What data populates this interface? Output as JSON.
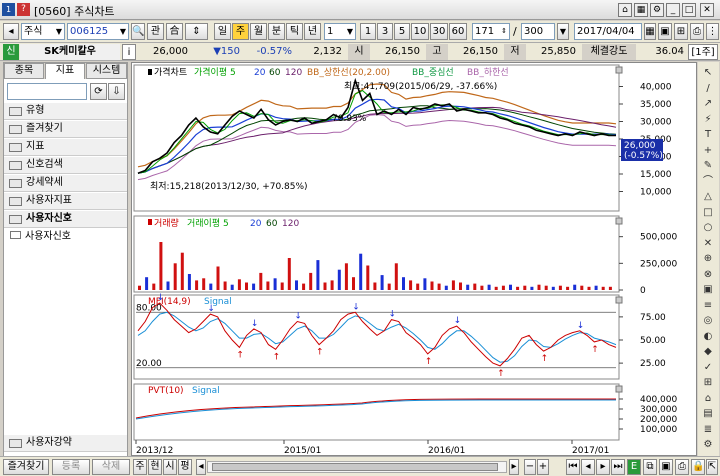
{
  "window": {
    "number_badge": "1",
    "help_badge": "?",
    "title": "[0560] 주식차트"
  },
  "toolbar": {
    "market": "주식",
    "code": "006125",
    "btn_chart": "관",
    "btn_up": "合",
    "periods": [
      "일",
      "주",
      "월",
      "분",
      "틱",
      "년"
    ],
    "selected_period": "주",
    "interval": "1",
    "intervals": [
      "1",
      "3",
      "5",
      "10",
      "30",
      "60"
    ],
    "bar_count": "171",
    "slash": "/",
    "max_count": "300",
    "date": "2017/04/04"
  },
  "quote": {
    "market_badge": "신",
    "name": "SK케미칼우",
    "info_btn": "i",
    "price": "26,000",
    "change": "▼150",
    "change_pct": "-0.57%",
    "volume": "2,132",
    "open_label": "시",
    "open": "26,150",
    "high_label": "고",
    "high": "26,150",
    "low_label": "저",
    "low": "25,850",
    "strength_label": "체결강도",
    "strength": "36.04",
    "unit": "[1주]"
  },
  "sidebar": {
    "tabs": [
      "종목",
      "지표",
      "시스템"
    ],
    "active_tab": "지표",
    "folders": [
      "유형",
      "즐겨찾기",
      "지표",
      "신호검색",
      "강세약세",
      "사용자지표",
      "사용자신호"
    ],
    "subitem": "사용자신호",
    "bottom_folder": "사용자강약"
  },
  "bottom_bar": {
    "btns": [
      "즐겨찾기",
      "등록",
      "삭제"
    ],
    "small_btns": [
      "주",
      "현",
      "시",
      "평"
    ]
  },
  "chart_data": [
    {
      "type": "line",
      "panel": "price",
      "legend": [
        "가격차트",
        "가격이평 5",
        "20",
        "60",
        "120",
        "BB_상한선(20,2.00)",
        "BB_중심선",
        "BB_하한선"
      ],
      "colors": {
        "price": "#000000",
        "ma5": "#00a000",
        "ma20": "#1a3fd6",
        "ma60": "#004400",
        "ma120": "#6b1f6b",
        "bb_up": "#c0681a",
        "bb_mid": "#119944",
        "bb_low": "#aa66aa"
      },
      "y_ticks": [
        "40,000",
        "35,000",
        "30,000",
        "25,000",
        "20,000",
        "15,000",
        "10,000"
      ],
      "ylim": [
        5000,
        45000
      ],
      "annotations": {
        "max": "최고:41,709(2015/06/29, -37.66%)",
        "min": "최저:15,218(2013/12/30, +70.85%)",
        "mid": "70.93%"
      },
      "last_price": "26,000",
      "last_change": "(-0.57%)",
      "price": [
        15218,
        16000,
        18500,
        19500,
        21000,
        24000,
        26000,
        29000,
        31000,
        28500,
        27000,
        26500,
        29000,
        31500,
        33000,
        32000,
        31000,
        33500,
        30500,
        29000,
        30000,
        30500,
        30000,
        31000,
        29500,
        30000,
        30500,
        32000,
        31000,
        34000,
        41709,
        36000,
        38000,
        32000,
        33000,
        32000,
        33500,
        32000,
        34000,
        33500,
        34000,
        35000,
        34500,
        35000,
        33000,
        33500,
        33000,
        32500,
        32500,
        32000,
        31000,
        30500,
        29500,
        29000,
        28500,
        27500,
        27000,
        26500,
        26000,
        26500,
        26000,
        27000,
        26500,
        26000,
        26500,
        26000,
        26000
      ]
    },
    {
      "type": "bar",
      "panel": "volume",
      "legend": [
        "거래량",
        "거래이평 5",
        "20",
        "60",
        "120"
      ],
      "y_ticks": [
        "500,000",
        "250,000",
        "0"
      ],
      "ylim": [
        0,
        600000
      ],
      "values": [
        40000,
        120000,
        60000,
        450000,
        80000,
        250000,
        350000,
        150000,
        90000,
        110000,
        60000,
        220000,
        80000,
        50000,
        100000,
        70000,
        60000,
        160000,
        80000,
        110000,
        70000,
        300000,
        90000,
        60000,
        160000,
        280000,
        70000,
        90000,
        190000,
        250000,
        120000,
        340000,
        230000,
        70000,
        140000,
        60000,
        250000,
        120000,
        90000,
        60000,
        110000,
        80000,
        60000,
        40000,
        90000,
        70000,
        50000,
        60000,
        40000,
        50000,
        30000,
        40000,
        50000,
        30000,
        40000,
        30000,
        50000,
        40000,
        30000,
        40000,
        30000,
        50000,
        40000,
        30000,
        40000,
        30000,
        30000
      ]
    },
    {
      "type": "line",
      "panel": "mfi",
      "legend": [
        "MFI(14,9)",
        "Signal"
      ],
      "y_ticks": [
        "75.00",
        "50.00",
        "25.00"
      ],
      "levels": [
        "80.00",
        "20.00"
      ],
      "ylim": [
        10,
        90
      ],
      "mfi": [
        60,
        70,
        85,
        90,
        82,
        72,
        65,
        58,
        62,
        70,
        78,
        75,
        60,
        50,
        42,
        55,
        62,
        58,
        45,
        40,
        50,
        62,
        70,
        68,
        55,
        45,
        52,
        60,
        72,
        78,
        80,
        70,
        62,
        55,
        60,
        72,
        70,
        58,
        52,
        45,
        35,
        42,
        55,
        62,
        65,
        58,
        48,
        40,
        32,
        25,
        22,
        30,
        40,
        52,
        55,
        45,
        38,
        42,
        50,
        55,
        58,
        60,
        55,
        48,
        50,
        45,
        42
      ],
      "signal": [
        55,
        60,
        70,
        78,
        80,
        76,
        70,
        64,
        60,
        63,
        70,
        73,
        68,
        60,
        52,
        52,
        56,
        57,
        52,
        46,
        48,
        55,
        62,
        65,
        60,
        52,
        52,
        56,
        64,
        72,
        76,
        74,
        68,
        62,
        60,
        64,
        67,
        63,
        57,
        50,
        42,
        40,
        46,
        54,
        60,
        60,
        54,
        47,
        39,
        31,
        26,
        27,
        33,
        43,
        50,
        49,
        43,
        42,
        46,
        51,
        55,
        58,
        57,
        52,
        50,
        48,
        45
      ]
    },
    {
      "type": "line",
      "panel": "pvt",
      "legend": [
        "PVT(10)",
        "Signal"
      ],
      "y_ticks": [
        "400,000",
        "300,000",
        "200,000",
        "100,000"
      ],
      "ylim": [
        0,
        500000
      ]
    }
  ],
  "x_axis": {
    "labels": [
      "2013/12",
      "2015/01",
      "2016/01",
      "2017/01"
    ]
  },
  "right_tools": [
    "↖",
    "/",
    "↗",
    "⚡",
    "T",
    "+",
    "✎",
    "⌒",
    "△",
    "□",
    "○",
    "✕",
    "⊕",
    "⊗",
    "▣",
    "≡",
    "◎",
    "◐",
    "◆",
    "✓",
    "⊞",
    "⌂",
    "▤",
    "≣",
    "⚙"
  ]
}
